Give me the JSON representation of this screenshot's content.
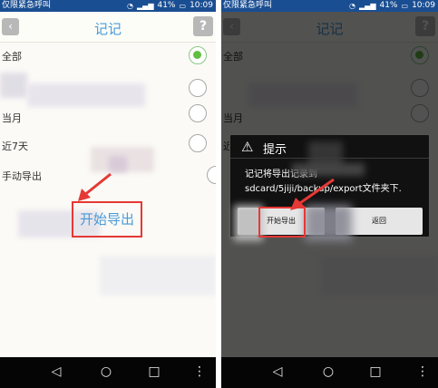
{
  "status_bar": {
    "carrier": "仅限紧急呼叫",
    "battery": "41%",
    "time": "10:09",
    "icons": [
      "carrier-badge-icon",
      "wifi-icon",
      "signal-icon",
      "battery-icon"
    ]
  },
  "left": {
    "header": {
      "title": "记记",
      "back_icon": "‹",
      "help_icon": "?"
    },
    "options": [
      {
        "label": "全部",
        "selected": true
      },
      {
        "label": "",
        "selected": false
      },
      {
        "label": "当月",
        "selected": false
      },
      {
        "label": "近7天",
        "selected": false
      },
      {
        "label": "手动导出",
        "selected": false
      }
    ],
    "export_button": "开始导出"
  },
  "right": {
    "header": {
      "title": "记记",
      "back_icon": "‹",
      "help_icon": "?"
    },
    "partial_labels": [
      "全部",
      "当月",
      "近"
    ],
    "dialog": {
      "title": "提示",
      "warning_icon": "⚠",
      "message_line1": "记记将导出记录到",
      "message_line2": "sdcard/5jiji/backup/export文件夹下.",
      "ok_button": "开始导出",
      "cancel_button": "返回"
    }
  },
  "navbar": {
    "back": "◁",
    "home": "○",
    "recents": "□",
    "menu": "⋮"
  },
  "colors": {
    "accent_blue": "#4a9ad8",
    "status_bar": "#1a4e92",
    "highlight_red": "#e53935",
    "radio_green": "#5fbf3f"
  }
}
